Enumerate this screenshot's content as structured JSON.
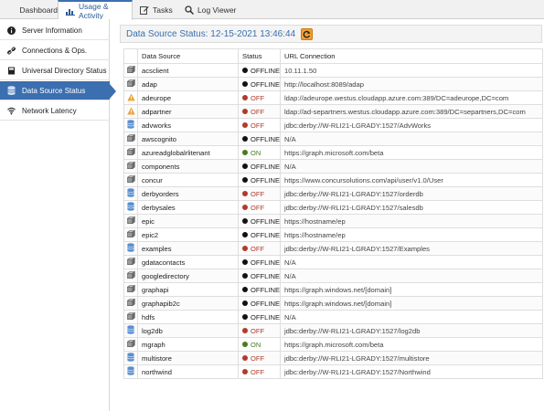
{
  "tabs": [
    {
      "label": "Dashboard",
      "icon": "home-icon",
      "active": false
    },
    {
      "label": "Usage & Activity",
      "icon": "chart-icon",
      "active": true
    },
    {
      "label": "Tasks",
      "icon": "edit-icon",
      "active": false
    },
    {
      "label": "Log Viewer",
      "icon": "search-icon",
      "active": false
    }
  ],
  "sidebar": {
    "items": [
      {
        "label": "Server Information",
        "icon": "info-icon"
      },
      {
        "label": "Connections & Ops.",
        "icon": "link-icon"
      },
      {
        "label": "Universal Directory Status",
        "icon": "book-icon"
      },
      {
        "label": "Data Source Status",
        "icon": "database-icon",
        "active": true
      },
      {
        "label": "Network Latency",
        "icon": "wifi-icon"
      }
    ]
  },
  "header": {
    "title": "Data Source Status: 12-15-2021 13:46:44",
    "refresh_icon": "refresh-icon"
  },
  "table": {
    "columns": [
      "Data Source",
      "Status",
      "URL Connection"
    ],
    "rows": [
      {
        "icon": "cube-icon",
        "name": "acsclient",
        "status": "OFFLINE",
        "url": "10.11.1.50"
      },
      {
        "icon": "cube-icon",
        "name": "adap",
        "status": "OFFLINE",
        "url": "http://localhost:8089/adap"
      },
      {
        "icon": "warning-icon",
        "name": "adeurope",
        "status": "OFF",
        "url": "ldap://adeurope.westus.cloudapp.azure.com:389/DC=adeurope,DC=com"
      },
      {
        "icon": "warning-icon",
        "name": "adpartner",
        "status": "OFF",
        "url": "ldap://ad-separtners.westus.cloudapp.azure.com:389/DC=separtners,DC=com"
      },
      {
        "icon": "database-icon",
        "name": "advworks",
        "status": "OFF",
        "url": "jdbc:derby://W-RLI21-LGRADY:1527/AdvWorks"
      },
      {
        "icon": "cube-icon",
        "name": "awscognito",
        "status": "OFFLINE",
        "url": "N/A"
      },
      {
        "icon": "cube-icon",
        "name": "azureadglobalrlitenant",
        "status": "ON",
        "url": "https://graph.microsoft.com/beta"
      },
      {
        "icon": "cube-icon",
        "name": "components",
        "status": "OFFLINE",
        "url": "N/A"
      },
      {
        "icon": "cube-icon",
        "name": "concur",
        "status": "OFFLINE",
        "url": "https://www.concursolutions.com/api/user/v1.0/User"
      },
      {
        "icon": "database-icon",
        "name": "derbyorders",
        "status": "OFF",
        "url": "jdbc:derby://W-RLI21-LGRADY:1527/orderdb"
      },
      {
        "icon": "database-icon",
        "name": "derbysales",
        "status": "OFF",
        "url": "jdbc:derby://W-RLI21-LGRADY:1527/salesdb"
      },
      {
        "icon": "cube-icon",
        "name": "epic",
        "status": "OFFLINE",
        "url": "https://hostname/ep"
      },
      {
        "icon": "cube-icon",
        "name": "epic2",
        "status": "OFFLINE",
        "url": "https://hostname/ep"
      },
      {
        "icon": "database-icon",
        "name": "examples",
        "status": "OFF",
        "url": "jdbc:derby://W-RLI21-LGRADY:1527/Examples"
      },
      {
        "icon": "cube-icon",
        "name": "gdatacontacts",
        "status": "OFFLINE",
        "url": "N/A"
      },
      {
        "icon": "cube-icon",
        "name": "googledirectory",
        "status": "OFFLINE",
        "url": "N/A"
      },
      {
        "icon": "cube-icon",
        "name": "graphapi",
        "status": "OFFLINE",
        "url": "https://graph.windows.net/[domain]"
      },
      {
        "icon": "cube-icon",
        "name": "graphapib2c",
        "status": "OFFLINE",
        "url": "https://graph.windows.net/[domain]"
      },
      {
        "icon": "cube-icon",
        "name": "hdfs",
        "status": "OFFLINE",
        "url": "N/A"
      },
      {
        "icon": "database-icon",
        "name": "log2db",
        "status": "OFF",
        "url": "jdbc:derby://W-RLI21-LGRADY:1527/log2db"
      },
      {
        "icon": "cube-icon",
        "name": "mgraph",
        "status": "ON",
        "url": "https://graph.microsoft.com/beta"
      },
      {
        "icon": "database-icon",
        "name": "multistore",
        "status": "OFF",
        "url": "jdbc:derby://W-RLI21-LGRADY:1527/multistore"
      },
      {
        "icon": "database-icon",
        "name": "northwind",
        "status": "OFF",
        "url": "jdbc:derby://W-RLI21-LGRADY:1527/Northwind"
      }
    ]
  },
  "colors": {
    "accent": "#3b6fb0",
    "off": "#b23a2a",
    "on": "#4b7a20",
    "offline": "#111111",
    "warning": "#e8a33a",
    "refresh": "#f0a030"
  }
}
